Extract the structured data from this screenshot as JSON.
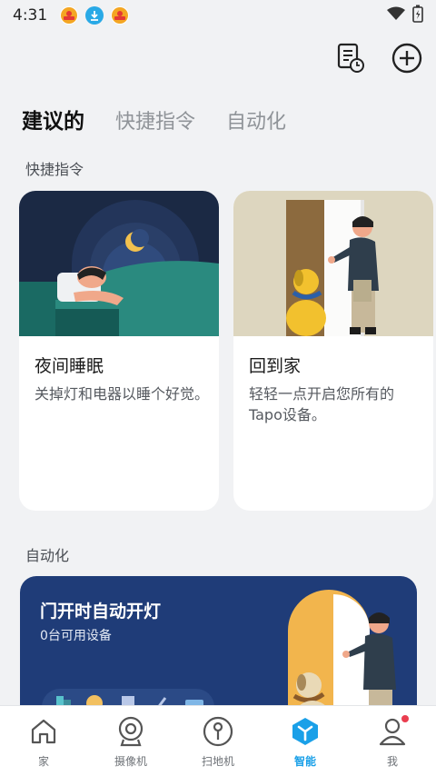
{
  "status_bar": {
    "time": "4:31",
    "notif_icons": [
      "badge-app-icon",
      "download-icon",
      "badge-app-icon"
    ],
    "right_icons": [
      "wifi-icon",
      "battery-icon"
    ]
  },
  "header": {
    "actions": [
      "log-icon",
      "add-icon"
    ]
  },
  "tabs": [
    {
      "label": "建议的",
      "active": true
    },
    {
      "label": "快捷指令",
      "active": false
    },
    {
      "label": "自动化",
      "active": false
    }
  ],
  "shortcuts_section": {
    "title": "快捷指令",
    "cards": [
      {
        "title": "夜间睡眠",
        "description": "关掉灯和电器以睡个好觉。"
      },
      {
        "title": "回到家",
        "description": "轻轻一点开启您所有的Tapo设备。"
      }
    ]
  },
  "automation_section": {
    "title": "自动化",
    "card": {
      "title": "门开时自动开灯",
      "subtitle": "0台可用设备"
    }
  },
  "bottom_nav": [
    {
      "label": "家",
      "icon": "home-icon",
      "active": false
    },
    {
      "label": "摄像机",
      "icon": "camera-icon",
      "active": false
    },
    {
      "label": "扫地机",
      "icon": "robot-vacuum-icon",
      "active": false
    },
    {
      "label": "智能",
      "icon": "smart-icon",
      "active": true
    },
    {
      "label": "我",
      "icon": "profile-icon",
      "active": false,
      "badge": true
    }
  ],
  "colors": {
    "accent": "#1aa0e8",
    "automation_card_bg": "#1f3c78",
    "page_bg": "#f1f2f4",
    "badge_red": "#ea3d4f"
  }
}
